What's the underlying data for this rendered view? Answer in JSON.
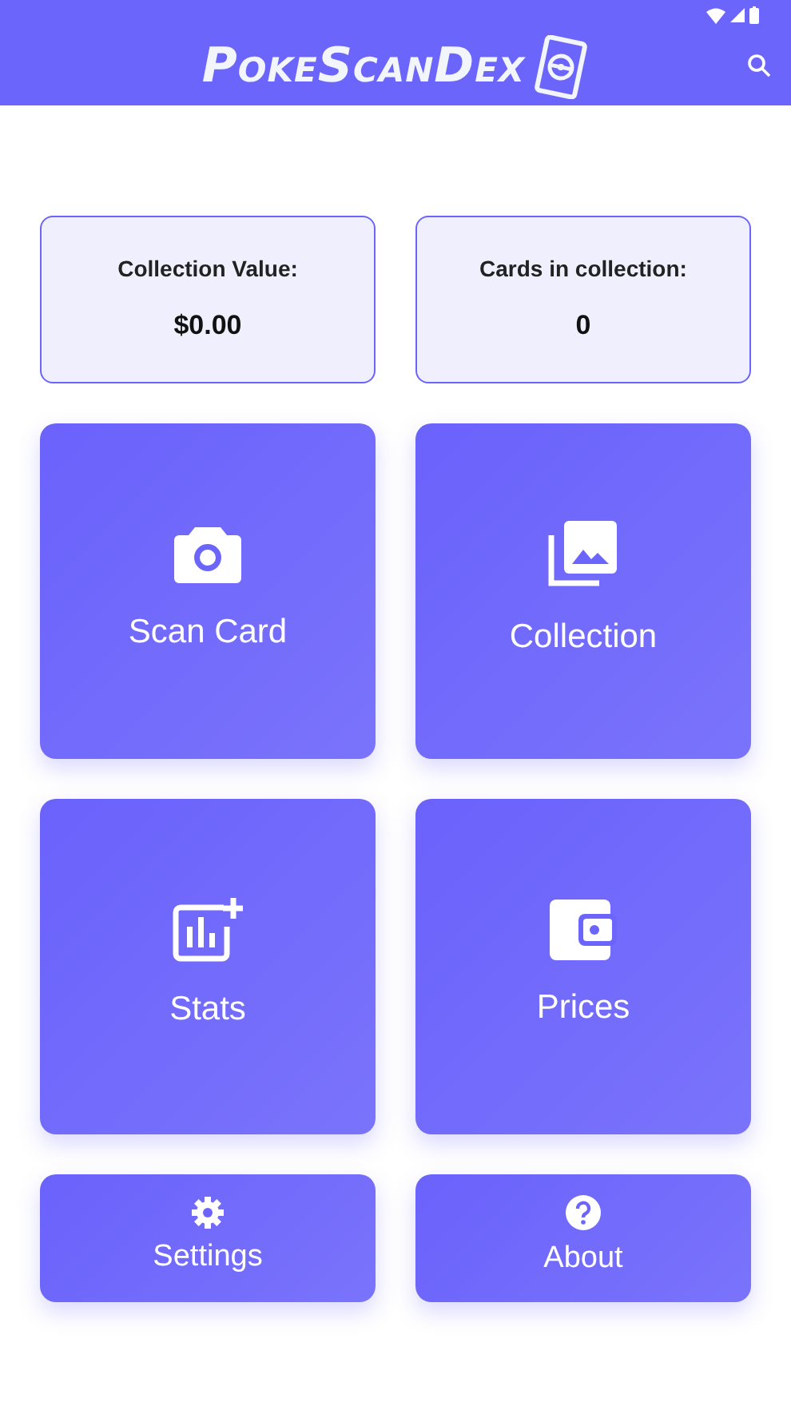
{
  "app_bar": {
    "title": "PokeScanDex"
  },
  "summary": [
    {
      "label": "Collection Value:",
      "value": "$0.00"
    },
    {
      "label": "Cards in collection:",
      "value": "0"
    }
  ],
  "tiles": [
    {
      "kind": "camera",
      "label": "Scan Card",
      "compact": false
    },
    {
      "kind": "gallery",
      "label": "Collection",
      "compact": false
    },
    {
      "kind": "stats",
      "label": "Stats",
      "compact": false
    },
    {
      "kind": "wallet",
      "label": "Prices",
      "compact": false
    },
    {
      "kind": "gear",
      "label": "Settings",
      "compact": true
    },
    {
      "kind": "help",
      "label": "About",
      "compact": true
    }
  ]
}
